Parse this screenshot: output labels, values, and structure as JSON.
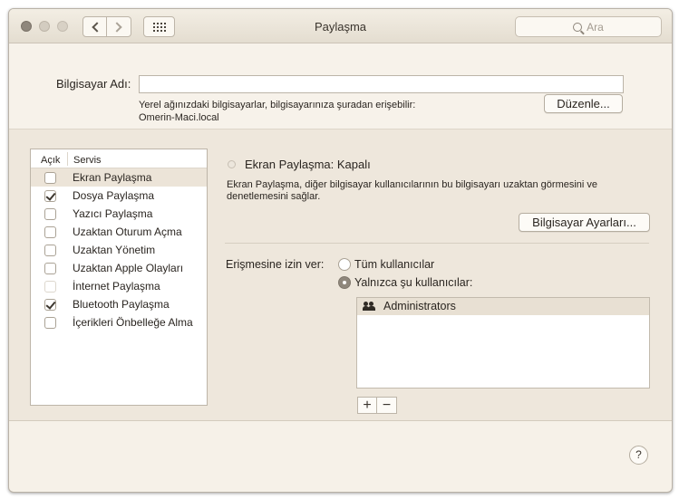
{
  "window": {
    "title": "Paylaşma",
    "search_placeholder": "Ara"
  },
  "computer_name": {
    "label": "Bilgisayar Adı:",
    "value": "",
    "info_line1": "Yerel ağınızdaki bilgisayarlar, bilgisayarınıza şuradan erişebilir:",
    "info_line2": "Omerin-Maci.local",
    "edit_button": "Düzenle..."
  },
  "services": {
    "header_on": "Açık",
    "header_service": "Servis",
    "items": [
      {
        "name": "Ekran Paylaşma",
        "checked": false,
        "selected": true
      },
      {
        "name": "Dosya Paylaşma",
        "checked": true,
        "selected": false
      },
      {
        "name": "Yazıcı Paylaşma",
        "checked": false,
        "selected": false
      },
      {
        "name": "Uzaktan Oturum Açma",
        "checked": false,
        "selected": false
      },
      {
        "name": "Uzaktan Yönetim",
        "checked": false,
        "selected": false
      },
      {
        "name": "Uzaktan Apple Olayları",
        "checked": false,
        "selected": false
      },
      {
        "name": "İnternet Paylaşma",
        "checked": false,
        "selected": false,
        "dimmed": true
      },
      {
        "name": "Bluetooth Paylaşma",
        "checked": true,
        "selected": false
      },
      {
        "name": "İçerikleri Önbelleğe Alma",
        "checked": false,
        "selected": false
      }
    ]
  },
  "detail": {
    "status": "Ekran Paylaşma: Kapalı",
    "description": "Ekran Paylaşma, diğer bilgisayar kullanıcılarının bu bilgisayarı uzaktan görmesini ve denetlemesini sağlar.",
    "settings_button": "Bilgisayar Ayarları...",
    "access_label": "Erişmesine izin ver:",
    "option_all": "Tüm kullanıcılar",
    "option_only": "Yalnızca şu kullanıcılar:",
    "selected_option": "only",
    "users": [
      "Administrators"
    ],
    "add_label": "+",
    "remove_label": "−"
  },
  "help_label": "?"
}
